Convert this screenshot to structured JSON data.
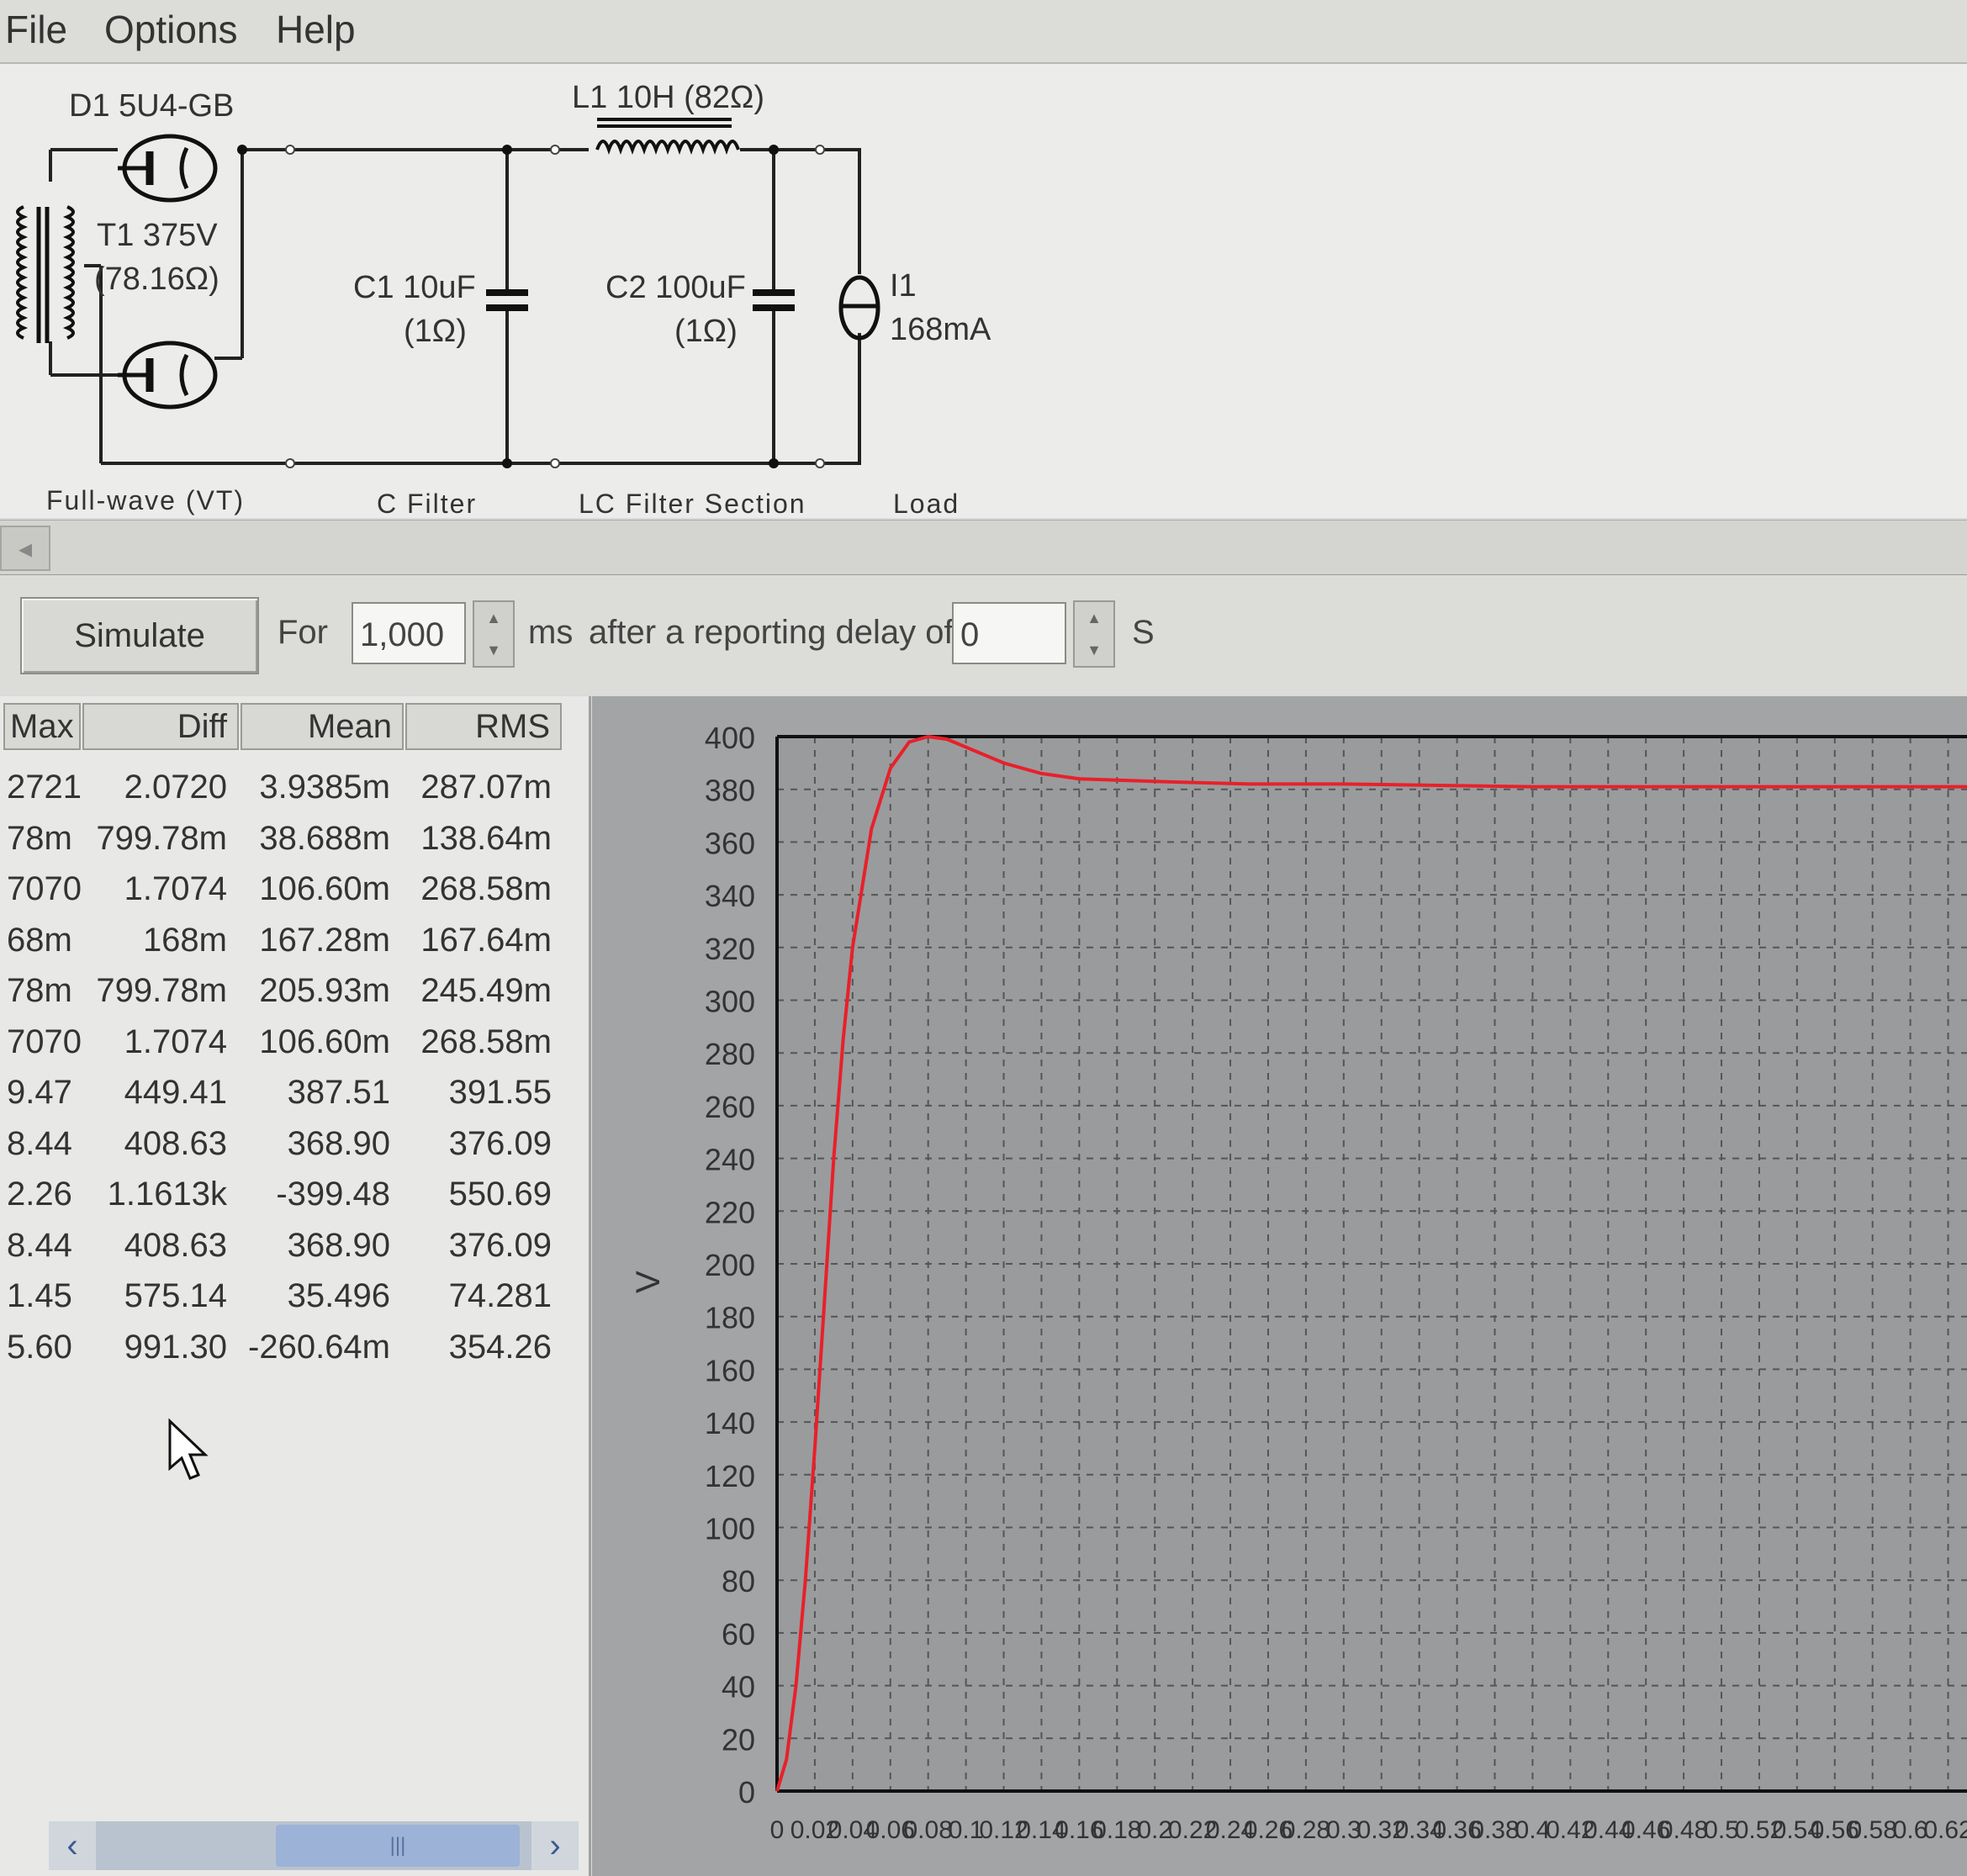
{
  "menu": {
    "items": [
      "File",
      "Options",
      "Help"
    ]
  },
  "schematic": {
    "d1_label": "D1 5U4-GB",
    "t1_label": "T1 375V",
    "t1_res": "(78.16Ω)",
    "l1_label": "L1 10H (82Ω)",
    "c1_label": "C1 10uF",
    "c1_res": "(1Ω)",
    "c2_label": "C2 100uF",
    "c2_res": "(1Ω)",
    "i1_label": "I1",
    "i1_value": "168mA",
    "section_fullwave": "Full-wave (VT)",
    "section_cfilter": "C Filter",
    "section_lc": "LC Filter Section",
    "section_load": "Load"
  },
  "controls": {
    "simulate_label": "Simulate",
    "for_label": "For",
    "duration_value": "1,000",
    "ms_label": "ms",
    "delay_label": "after a reporting delay of",
    "delay_value": "0",
    "s_label": "S"
  },
  "table": {
    "columns": [
      "Max",
      "Diff",
      "Mean",
      "RMS"
    ],
    "rows": [
      [
        "2721",
        "2.0720",
        "3.9385m",
        "287.07m"
      ],
      [
        "78m",
        "799.78m",
        "38.688m",
        "138.64m"
      ],
      [
        "7070",
        "1.7074",
        "106.60m",
        "268.58m"
      ],
      [
        "68m",
        "168m",
        "167.28m",
        "167.64m"
      ],
      [
        "78m",
        "799.78m",
        "205.93m",
        "245.49m"
      ],
      [
        "7070",
        "1.7074",
        "106.60m",
        "268.58m"
      ],
      [
        "9.47",
        "449.41",
        "387.51",
        "391.55"
      ],
      [
        "8.44",
        "408.63",
        "368.90",
        "376.09"
      ],
      [
        "2.26",
        "1.1613k",
        "-399.48",
        "550.69"
      ],
      [
        "8.44",
        "408.63",
        "368.90",
        "376.09"
      ],
      [
        "1.45",
        "575.14",
        "35.496",
        "74.281"
      ],
      [
        "5.60",
        "991.30",
        "-260.64m",
        "354.26"
      ]
    ]
  },
  "chart_data": {
    "type": "line",
    "ylabel": "V",
    "ylim": [
      0,
      400
    ],
    "yticks": [
      0,
      20,
      40,
      60,
      80,
      100,
      120,
      140,
      160,
      180,
      200,
      220,
      240,
      260,
      280,
      300,
      320,
      340,
      360,
      380,
      400
    ],
    "xlim": [
      0,
      0.63
    ],
    "xticks": [
      "0",
      "0.02",
      "0.04",
      "0.06",
      "0.08",
      "0.1",
      "0.12",
      "0.14",
      "0.16",
      "0.18",
      "0.2",
      "0.22",
      "0.24",
      "0.26",
      "0.28",
      "0.3",
      "0.32",
      "0.34",
      "0.36",
      "0.38",
      "0.4",
      "0.42",
      "0.44",
      "0.46",
      "0.48",
      "0.5",
      "0.52",
      "0.54",
      "0.56",
      "0.58",
      "0.6",
      "0.62"
    ],
    "grid": true,
    "line_color": "#e8202a",
    "series": [
      {
        "x": [
          0,
          0.005,
          0.01,
          0.015,
          0.02,
          0.025,
          0.03,
          0.035,
          0.04,
          0.05,
          0.06,
          0.07,
          0.08,
          0.09,
          0.1,
          0.12,
          0.14,
          0.16,
          0.2,
          0.25,
          0.3,
          0.4,
          0.5,
          0.63
        ],
        "y": [
          0,
          12,
          40,
          80,
          130,
          185,
          240,
          285,
          320,
          365,
          388,
          398,
          400,
          399,
          396,
          390,
          386,
          384,
          383,
          382,
          382,
          381,
          381,
          381
        ]
      }
    ]
  }
}
